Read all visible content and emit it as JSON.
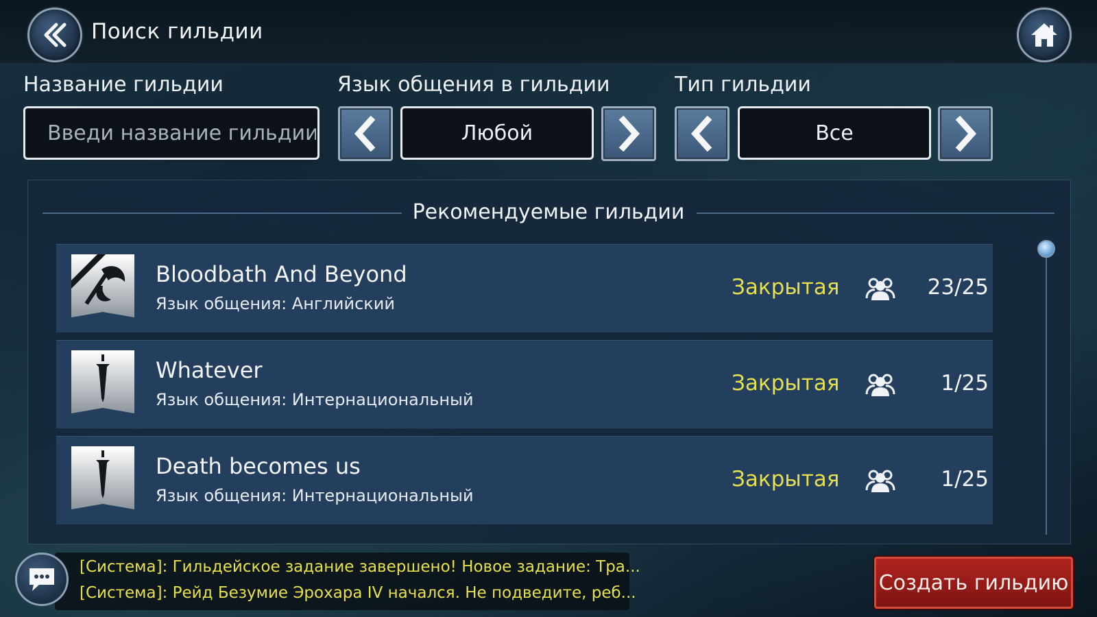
{
  "header": {
    "title": "Поиск гильдии",
    "back_icon": "double-chevron-left-icon",
    "home_icon": "home-icon"
  },
  "filters": {
    "name_label": "Название гильдии",
    "name_placeholder": "Введи название гильдии",
    "language_label": "Язык общения в гильдии",
    "language_value": "Любой",
    "type_label": "Тип гильдии",
    "type_value": "Все"
  },
  "panel": {
    "title": "Рекомендуемые гильдии"
  },
  "guilds": [
    {
      "name": "Bloodbath And Beyond",
      "language": "Язык общения: Английский",
      "status": "Закрытая",
      "members": "23/25",
      "crest_icon": "axe-crest-icon"
    },
    {
      "name": "Whatever",
      "language": "Язык общения: Интернациональный",
      "status": "Закрытая",
      "members": "1/25",
      "crest_icon": "sword-crest-icon"
    },
    {
      "name": "Death becomes us",
      "language": "Язык общения: Интернациональный",
      "status": "Закрытая",
      "members": "1/25",
      "crest_icon": "sword-crest-icon"
    }
  ],
  "chat": {
    "lines": [
      "[Система]: Гильдейское задание завершено! Новое задание: Тра...",
      "[Система]: Рейд Безумие Эрохара IV начался. Не подведите, реб..."
    ]
  },
  "actions": {
    "create_label": "Создать гильдию"
  },
  "colors": {
    "status": "#e6e04c",
    "create_button": "#b0231f",
    "row_bg": "#243e5e"
  }
}
